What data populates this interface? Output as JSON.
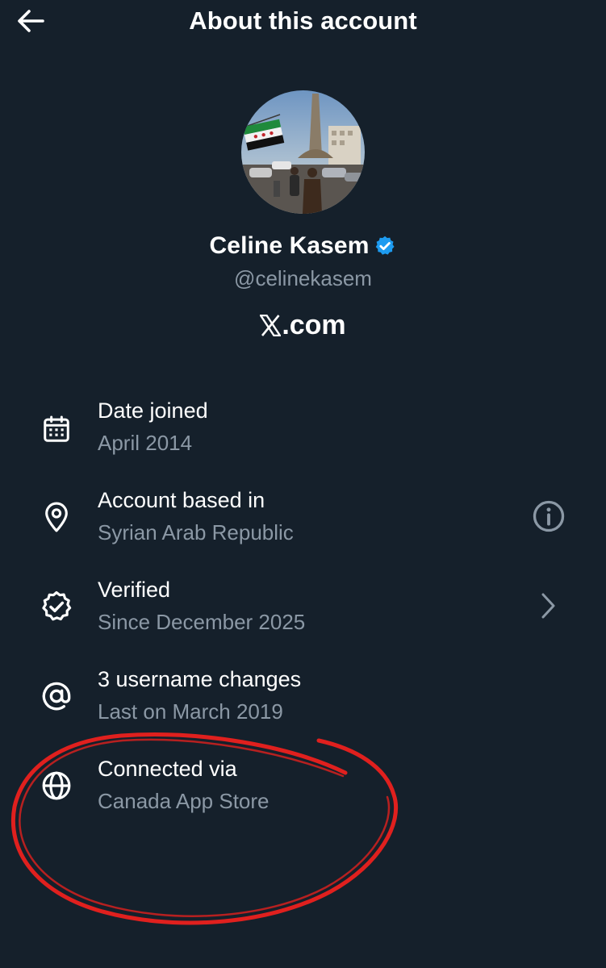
{
  "header": {
    "title": "About this account",
    "back_icon": "arrow-left-icon"
  },
  "profile": {
    "display_name": "Celine Kasem",
    "handle": "@celinekasem",
    "verified_icon": "verified-badge-icon",
    "verified_color": "#1d9bf0",
    "domain": ".com",
    "domain_logo": "x-logo-icon"
  },
  "details": [
    {
      "icon": "calendar-icon",
      "label": "Date joined",
      "value": "April 2014",
      "action": ""
    },
    {
      "icon": "location-pin-icon",
      "label": "Account based in",
      "value": "Syrian Arab Republic",
      "action": "info-icon"
    },
    {
      "icon": "verified-check-icon",
      "label": "Verified",
      "value": "Since December 2025",
      "action": "chevron-right-icon"
    },
    {
      "icon": "at-sign-icon",
      "label": "3 username changes",
      "value": "Last on March 2019",
      "action": ""
    },
    {
      "icon": "globe-icon",
      "label": "Connected via",
      "value": "Canada App Store",
      "action": ""
    }
  ],
  "annotation": {
    "type": "hand-drawn-circle",
    "color": "#e0201e"
  },
  "colors": {
    "background": "#15202b",
    "primary_text": "#ffffff",
    "secondary_text": "#8b98a5"
  }
}
